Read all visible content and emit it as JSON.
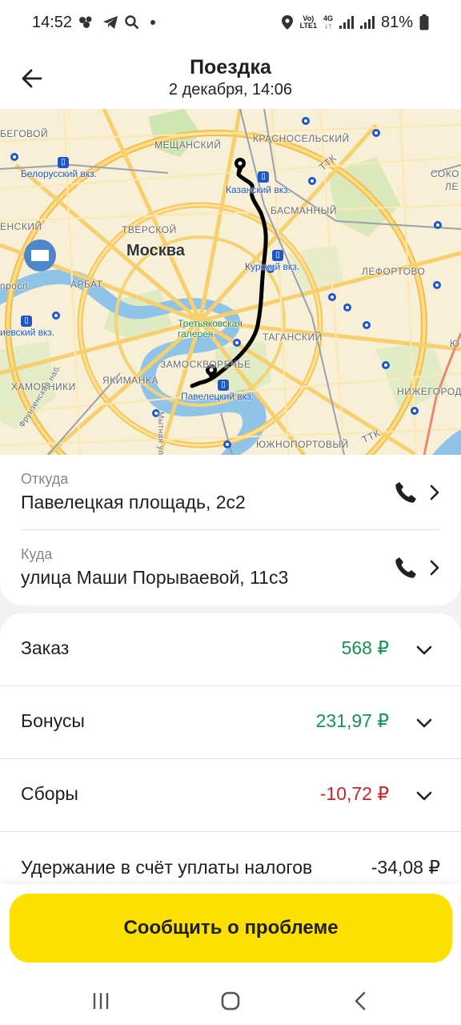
{
  "status_bar": {
    "time": "14:52",
    "battery": "81%",
    "network_top": "Vo)",
    "network_bottom": "LTE1",
    "gen": "4G"
  },
  "header": {
    "title": "Поездка",
    "subtitle": "2 декабря, 14:06"
  },
  "map": {
    "labels": {
      "city": "Москва",
      "meshchansky": "МЕЩАНСКИЙ",
      "krasnoselsky": "КРАСНОСЕЛЬСКИЙ",
      "begovoy": "БЕГОВОЙ",
      "belorussky": "Белорусский вкз.",
      "kazansky": "Казанский вкз.",
      "basmanny": "БАСМАННЫЙ",
      "presnensky": "ЕНСКИЙ",
      "tverskoy": "ТВЕРСКОЙ",
      "kursky": "Курский вкз.",
      "lefortovo": "ЛЕФОРТОВО",
      "arbat": "АРБАТ",
      "prosp": "просп.",
      "kievsky": "иевский вкз.",
      "tretyakov": "Третьяковская галерея",
      "tagansky": "ТАГАНСКИЙ",
      "zamoskvorechye": "ЗАМОСКВОРЕЧЬЕ",
      "khamovniki": "ХАМОВНИКИ",
      "yakimanka": "ЯКИМАНКА",
      "paveletsky": "Павелецкий вкз.",
      "nizhegorod": "НИЖЕГОРОД",
      "yuzhnoportovy": "ЮЖНОПОРТОВЫЙ",
      "ttk1": "ТТК",
      "ttk2": "ТТК",
      "sokol": "СОКО",
      "lefort2": "ЛЕ",
      "frunzenskaya": "Фрунзенская наб.",
      "mytnaya": "Мытная ул.",
      "yu": "Ю"
    }
  },
  "route": {
    "from_label": "Откуда",
    "from_address": "Павелецкая площадь, 2с2",
    "to_label": "Куда",
    "to_address": "улица Маши Порываевой, 11с3"
  },
  "payments": {
    "rows": [
      {
        "label": "Заказ",
        "amount": "568 ₽",
        "tone": "positive"
      },
      {
        "label": "Бонусы",
        "amount": "231,97 ₽",
        "tone": "positive"
      },
      {
        "label": "Сборы",
        "amount": "-10,72 ₽",
        "tone": "negative"
      }
    ],
    "tax_label": "Удержание в счёт уплаты налогов",
    "tax_amount": "-34,08 ₽"
  },
  "actions": {
    "report_problem": "Сообщить о проблеме"
  },
  "colors": {
    "accent_yellow": "#fce000",
    "positive_green": "#19904f",
    "negative_red": "#c8262e"
  }
}
